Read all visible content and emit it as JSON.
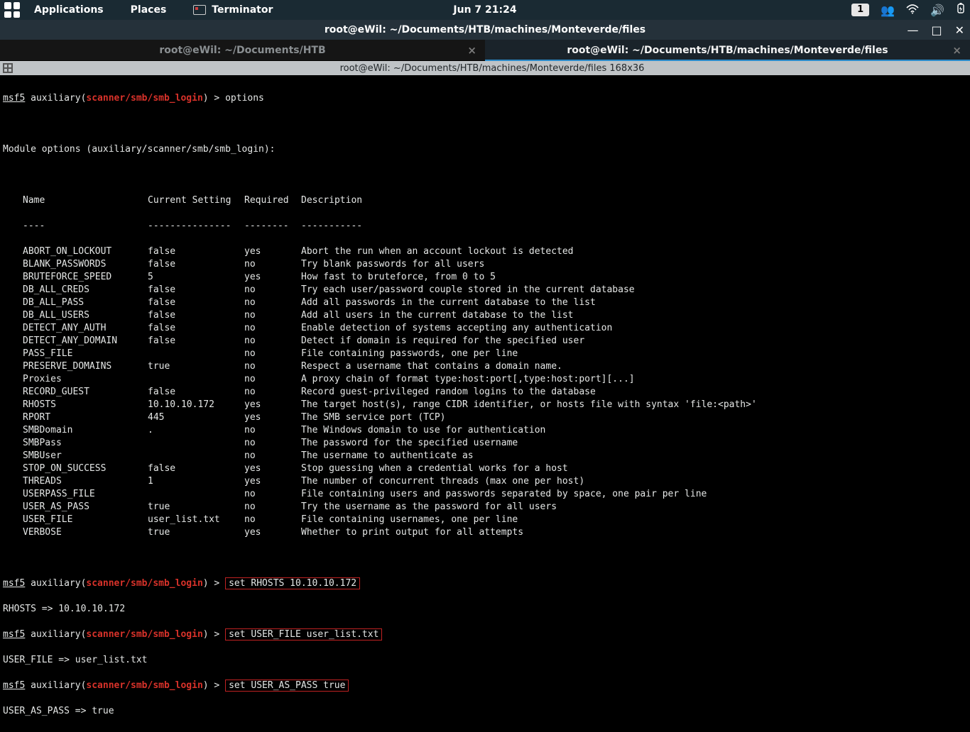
{
  "topbar": {
    "applications": "Applications",
    "places": "Places",
    "appname": "Terminator",
    "clock": "Jun 7  21:24",
    "workspace": "1"
  },
  "window": {
    "title": "root@eWil: ~/Documents/HTB/machines/Monteverde/files"
  },
  "tabs": {
    "left": "root@eWil: ~/Documents/HTB",
    "right": "root@eWil: ~/Documents/HTB/machines/Monteverde/files"
  },
  "subbar": {
    "path": "root@eWil: ~/Documents/HTB/machines/Monteverde/files 168x36"
  },
  "prompt": {
    "msf": "msf5",
    "aux_open": " auxiliary(",
    "mod": "scanner/smb/smb_login",
    "aux_close": ") > ",
    "cmd_options": "options"
  },
  "hdr": {
    "module": "Module options (auxiliary/scanner/smb/smb_login):",
    "name": "Name",
    "cur": "Current Setting",
    "req": "Required",
    "desc": "Description",
    "dname": "----",
    "dcur": "---------------",
    "dreq": "--------",
    "ddesc": "-----------"
  },
  "opts": [
    {
      "n": "ABORT_ON_LOCKOUT",
      "c": "false",
      "r": "yes",
      "d": "Abort the run when an account lockout is detected"
    },
    {
      "n": "BLANK_PASSWORDS",
      "c": "false",
      "r": "no",
      "d": "Try blank passwords for all users"
    },
    {
      "n": "BRUTEFORCE_SPEED",
      "c": "5",
      "r": "yes",
      "d": "How fast to bruteforce, from 0 to 5"
    },
    {
      "n": "DB_ALL_CREDS",
      "c": "false",
      "r": "no",
      "d": "Try each user/password couple stored in the current database"
    },
    {
      "n": "DB_ALL_PASS",
      "c": "false",
      "r": "no",
      "d": "Add all passwords in the current database to the list"
    },
    {
      "n": "DB_ALL_USERS",
      "c": "false",
      "r": "no",
      "d": "Add all users in the current database to the list"
    },
    {
      "n": "DETECT_ANY_AUTH",
      "c": "false",
      "r": "no",
      "d": "Enable detection of systems accepting any authentication"
    },
    {
      "n": "DETECT_ANY_DOMAIN",
      "c": "false",
      "r": "no",
      "d": "Detect if domain is required for the specified user"
    },
    {
      "n": "PASS_FILE",
      "c": "",
      "r": "no",
      "d": "File containing passwords, one per line"
    },
    {
      "n": "PRESERVE_DOMAINS",
      "c": "true",
      "r": "no",
      "d": "Respect a username that contains a domain name."
    },
    {
      "n": "Proxies",
      "c": "",
      "r": "no",
      "d": "A proxy chain of format type:host:port[,type:host:port][...]"
    },
    {
      "n": "RECORD_GUEST",
      "c": "false",
      "r": "no",
      "d": "Record guest-privileged random logins to the database"
    },
    {
      "n": "RHOSTS",
      "c": "10.10.10.172",
      "r": "yes",
      "d": "The target host(s), range CIDR identifier, or hosts file with syntax 'file:<path>'"
    },
    {
      "n": "RPORT",
      "c": "445",
      "r": "yes",
      "d": "The SMB service port (TCP)"
    },
    {
      "n": "SMBDomain",
      "c": ".",
      "r": "no",
      "d": "The Windows domain to use for authentication"
    },
    {
      "n": "SMBPass",
      "c": "",
      "r": "no",
      "d": "The password for the specified username"
    },
    {
      "n": "SMBUser",
      "c": "",
      "r": "no",
      "d": "The username to authenticate as"
    },
    {
      "n": "STOP_ON_SUCCESS",
      "c": "false",
      "r": "yes",
      "d": "Stop guessing when a credential works for a host"
    },
    {
      "n": "THREADS",
      "c": "1",
      "r": "yes",
      "d": "The number of concurrent threads (max one per host)"
    },
    {
      "n": "USERPASS_FILE",
      "c": "",
      "r": "no",
      "d": "File containing users and passwords separated by space, one pair per line"
    },
    {
      "n": "USER_AS_PASS",
      "c": "true",
      "r": "no",
      "d": "Try the username as the password for all users"
    },
    {
      "n": "USER_FILE",
      "c": "user_list.txt",
      "r": "no",
      "d": "File containing usernames, one per line"
    },
    {
      "n": "VERBOSE",
      "c": "true",
      "r": "yes",
      "d": "Whether to print output for all attempts"
    }
  ],
  "cmds": {
    "set1": "set RHOSTS 10.10.10.172",
    "res1": "RHOSTS => 10.10.10.172",
    "set2": "set USER_FILE user_list.txt",
    "res2": "USER_FILE => user_list.txt",
    "set3": "set USER_AS_PASS true",
    "res3": "USER_AS_PASS => true"
  }
}
